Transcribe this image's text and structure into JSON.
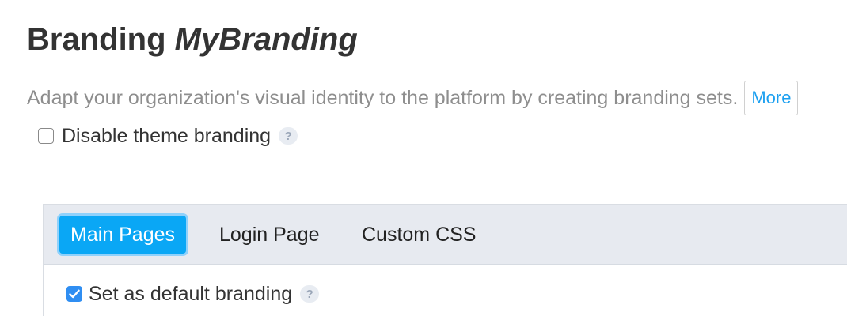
{
  "header": {
    "title_prefix": "Branding",
    "title_name": "MyBranding"
  },
  "intro": {
    "description": "Adapt your organization's visual identity to the platform by creating branding sets.",
    "more_label": "More"
  },
  "disable_theme": {
    "label": "Disable theme branding",
    "checked": false,
    "help": "?"
  },
  "tabs": [
    {
      "label": "Main Pages",
      "active": true
    },
    {
      "label": "Login Page",
      "active": false
    },
    {
      "label": "Custom CSS",
      "active": false
    }
  ],
  "default_branding": {
    "label": "Set as default branding",
    "checked": true,
    "help": "?"
  },
  "colors": {
    "accent": "#0aa7f5",
    "link": "#1a9ff0",
    "checkbox_checked": "#2f8ef2"
  }
}
